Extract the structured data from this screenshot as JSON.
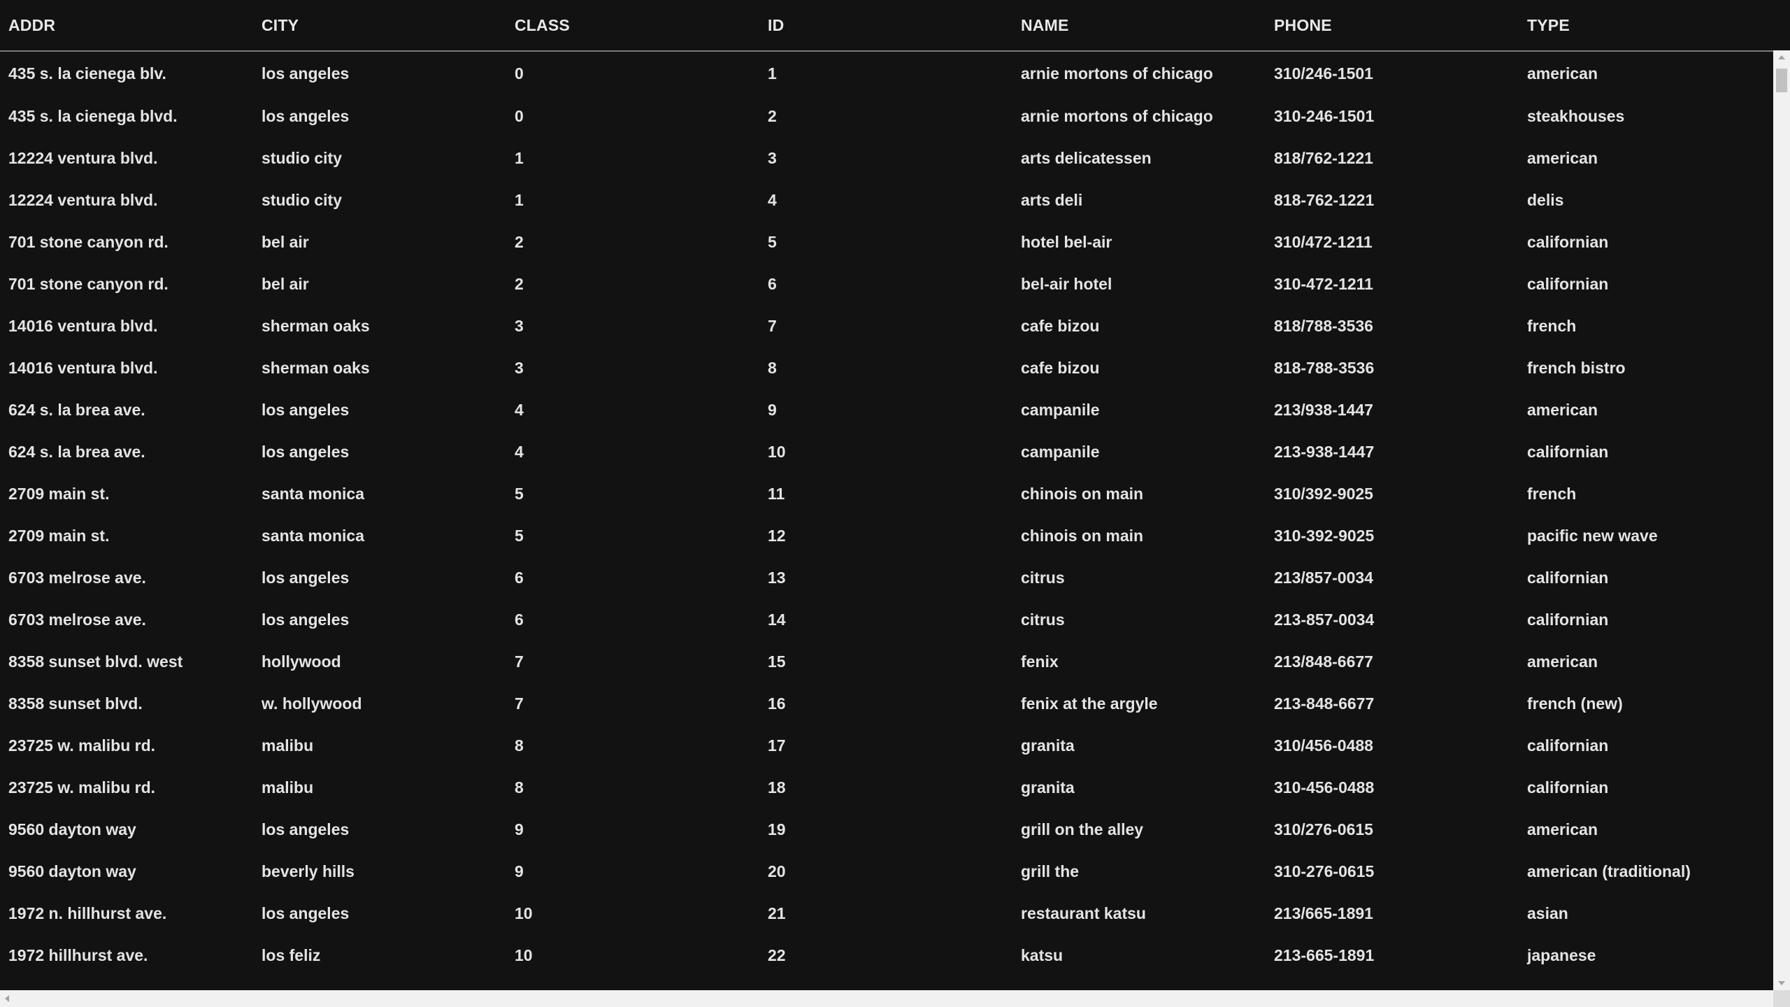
{
  "table": {
    "columns": [
      "ADDR",
      "CITY",
      "CLASS",
      "ID",
      "NAME",
      "PHONE",
      "TYPE"
    ],
    "rows": [
      [
        "435 s. la cienega blv.",
        "los angeles",
        "0",
        "1",
        "arnie mortons of chicago",
        "310/246-1501",
        "american"
      ],
      [
        "435 s. la cienega blvd.",
        "los angeles",
        "0",
        "2",
        "arnie mortons of chicago",
        "310-246-1501",
        "steakhouses"
      ],
      [
        "12224 ventura blvd.",
        "studio city",
        "1",
        "3",
        "arts delicatessen",
        "818/762-1221",
        "american"
      ],
      [
        "12224 ventura blvd.",
        "studio city",
        "1",
        "4",
        "arts deli",
        "818-762-1221",
        "delis"
      ],
      [
        "701 stone canyon rd.",
        "bel air",
        "2",
        "5",
        "hotel bel-air",
        "310/472-1211",
        "californian"
      ],
      [
        "701 stone canyon rd.",
        "bel air",
        "2",
        "6",
        "bel-air hotel",
        "310-472-1211",
        "californian"
      ],
      [
        "14016 ventura blvd.",
        "sherman oaks",
        "3",
        "7",
        "cafe bizou",
        "818/788-3536",
        "french"
      ],
      [
        "14016 ventura blvd.",
        "sherman oaks",
        "3",
        "8",
        "cafe bizou",
        "818-788-3536",
        "french bistro"
      ],
      [
        "624 s. la brea ave.",
        "los angeles",
        "4",
        "9",
        "campanile",
        "213/938-1447",
        "american"
      ],
      [
        "624 s. la brea ave.",
        "los angeles",
        "4",
        "10",
        "campanile",
        "213-938-1447",
        "californian"
      ],
      [
        "2709 main st.",
        "santa monica",
        "5",
        "11",
        "chinois on main",
        "310/392-9025",
        "french"
      ],
      [
        "2709 main st.",
        "santa monica",
        "5",
        "12",
        "chinois on main",
        "310-392-9025",
        "pacific new wave"
      ],
      [
        "6703 melrose ave.",
        "los angeles",
        "6",
        "13",
        "citrus",
        "213/857-0034",
        "californian"
      ],
      [
        "6703 melrose ave.",
        "los angeles",
        "6",
        "14",
        "citrus",
        "213-857-0034",
        "californian"
      ],
      [
        "8358 sunset blvd. west",
        "hollywood",
        "7",
        "15",
        "fenix",
        "213/848-6677",
        "american"
      ],
      [
        "8358 sunset blvd.",
        "w. hollywood",
        "7",
        "16",
        "fenix at the argyle",
        "213-848-6677",
        "french (new)"
      ],
      [
        "23725 w. malibu rd.",
        "malibu",
        "8",
        "17",
        "granita",
        "310/456-0488",
        "californian"
      ],
      [
        "23725 w. malibu rd.",
        "malibu",
        "8",
        "18",
        "granita",
        "310-456-0488",
        "californian"
      ],
      [
        "9560 dayton way",
        "los angeles",
        "9",
        "19",
        "grill on the alley",
        "310/276-0615",
        "american"
      ],
      [
        "9560 dayton way",
        "beverly hills",
        "9",
        "20",
        "grill the",
        "310-276-0615",
        "american (traditional)"
      ],
      [
        "1972 n. hillhurst ave.",
        "los angeles",
        "10",
        "21",
        "restaurant katsu",
        "213/665-1891",
        "asian"
      ],
      [
        "1972 hillhurst ave.",
        "los feliz",
        "10",
        "22",
        "katsu",
        "213-665-1891",
        "japanese"
      ]
    ]
  },
  "scrollbars": {
    "up_icon": "scroll-up-arrow",
    "down_icon": "scroll-down-arrow",
    "left_icon": "scroll-left-arrow"
  }
}
